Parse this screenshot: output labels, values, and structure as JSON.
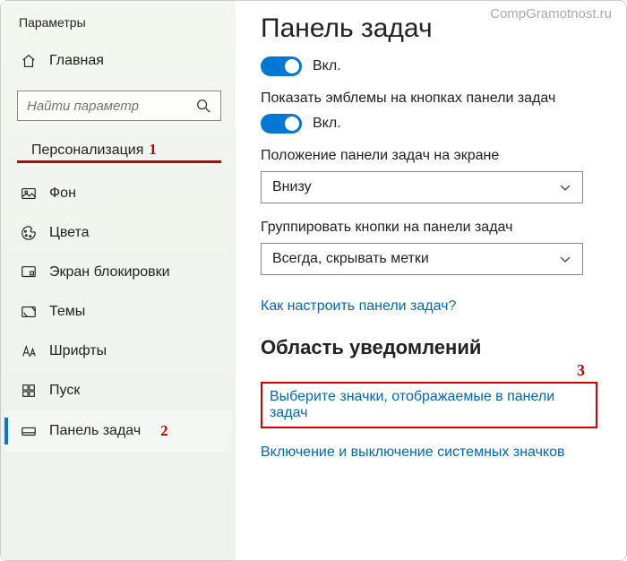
{
  "watermark": "CompGramotnost.ru",
  "sidebar": {
    "title": "Параметры",
    "home": "Главная",
    "searchPlaceholder": "Найти параметр",
    "section": "Персонализация",
    "annot1": "1",
    "items": {
      "background": "Фон",
      "colors": "Цвета",
      "lockscreen": "Экран блокировки",
      "themes": "Темы",
      "fonts": "Шрифты",
      "start": "Пуск",
      "taskbar": "Панель задач"
    },
    "annot2": "2"
  },
  "main": {
    "title": "Панель задач",
    "toggle1Label": "Вкл.",
    "setting1Label": "Показать эмблемы на кнопках панели задач",
    "toggle2Label": "Вкл.",
    "position": {
      "label": "Положение панели задач на экране",
      "value": "Внизу"
    },
    "grouping": {
      "label": "Группировать кнопки на панели задач",
      "value": "Всегда, скрывать метки"
    },
    "howToLink": "Как настроить панели задач?",
    "notificationArea": {
      "title": "Область уведомлений",
      "annot3": "3",
      "selectIcons": "Выберите значки, отображаемые в панели задач",
      "systemIcons": "Включение и выключение системных значков"
    }
  }
}
